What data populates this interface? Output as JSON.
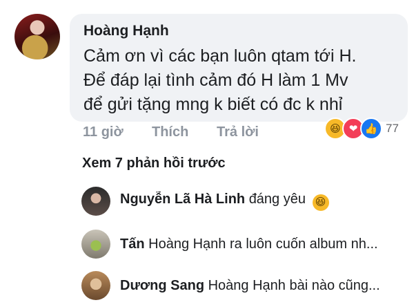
{
  "comment": {
    "author": "Hoàng Hạnh",
    "text_lines": [
      "Cảm ơn vì các bạn luôn qtam tới H.",
      "Để đáp lại tình cảm đó H làm 1 Mv",
      "để gửi tặng mng k biết có đc k nhỉ"
    ],
    "time": "11 giờ",
    "like_label": "Thích",
    "reply_label": "Trả lời",
    "reactions": {
      "icons": [
        "haha-icon",
        "love-icon",
        "like-icon"
      ],
      "count": "77"
    }
  },
  "view_more_label": "Xem 7 phản hồi trước",
  "replies": [
    {
      "name": "Nguyễn Lã Hà Linh",
      "text": "đáng yêu",
      "emoji": "haha-icon"
    },
    {
      "name": "Tấn",
      "text": "Hoàng Hạnh ra luôn cuốn album nh..."
    },
    {
      "name": "Dương Sang",
      "text": "Hoàng Hạnh bài nào cũng..."
    }
  ],
  "colors": {
    "bubble_bg": "#f0f2f5",
    "meta_text": "#8d949e",
    "like_blue": "#1877f2",
    "love_red": "#f33e58",
    "haha_yellow": "#f7b928"
  }
}
